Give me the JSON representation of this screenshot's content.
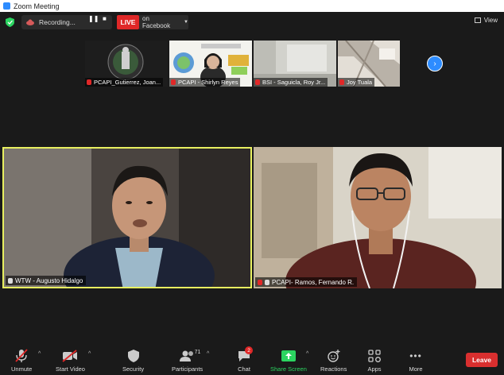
{
  "window": {
    "title": "Zoom Meeting"
  },
  "topbar": {
    "recording_label": "Recording...",
    "pause_glyph": "❚❚",
    "stop_glyph": "■",
    "live_label": "LIVE",
    "live_target": "on Facebook",
    "view_label": "View"
  },
  "thumbnails": [
    {
      "name": "PCAPI_Gutierrez, Joan...",
      "muted": true
    },
    {
      "name": "PCAPI - Shirlyn Reyes",
      "muted": true
    },
    {
      "name": "BSI - Saguicla, Roy Jr...",
      "muted": true
    },
    {
      "name": "Joy Tuala",
      "muted": true
    }
  ],
  "main_tiles": [
    {
      "name": "WTW - Augusto Hidalgo",
      "active_speaker": true
    },
    {
      "name": "PCAPI- Ramos, Fernando R.",
      "active_speaker": false
    }
  ],
  "toolbar": {
    "unmute": "Unmute",
    "start_video": "Start Video",
    "security": "Security",
    "participants": "Participants",
    "participants_count": "71",
    "chat": "Chat",
    "chat_badge": "2",
    "share_screen": "Share Screen",
    "reactions": "Reactions",
    "apps": "Apps",
    "more": "More",
    "leave": "Leave"
  },
  "colors": {
    "accent": "#2d8cff",
    "live_red": "#e02828",
    "active_border": "#e8f060",
    "share_green": "#2bd460",
    "leave_red": "#d92f2f"
  }
}
